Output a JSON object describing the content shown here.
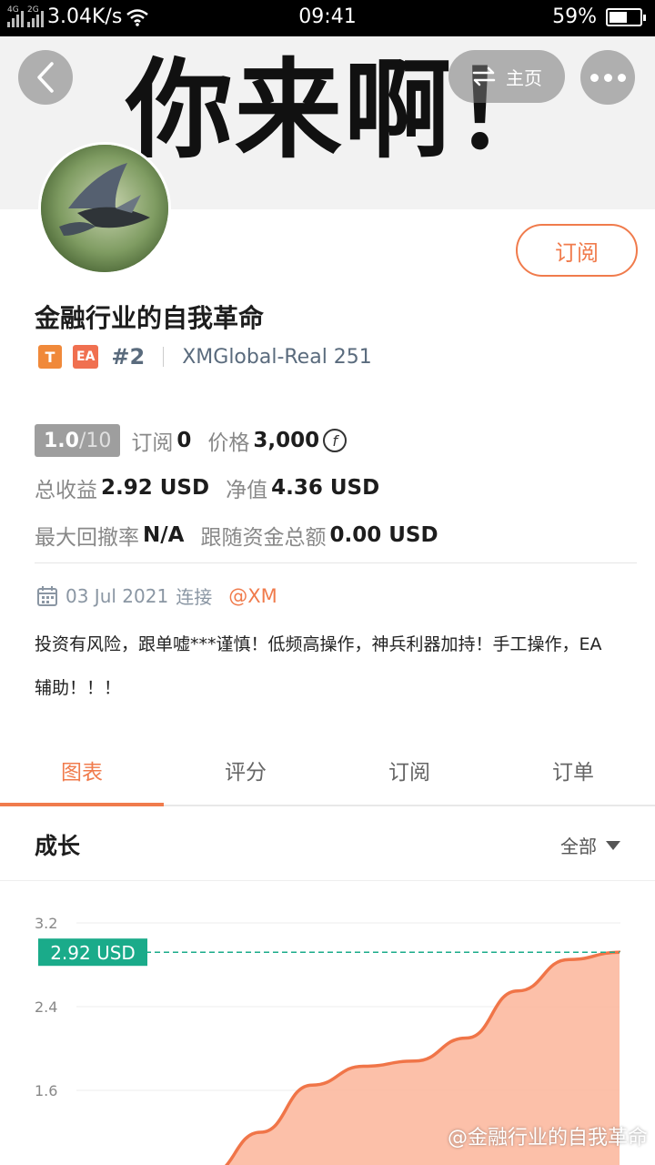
{
  "status_bar": {
    "network_1": "4G",
    "network_2": "2G",
    "speed": "3.04K/s",
    "time": "09:41",
    "battery_percent": "59%",
    "battery_level": 0.59
  },
  "banner": {
    "text": "你来啊！",
    "home_label": "主页"
  },
  "profile": {
    "subscribe_label": "订阅",
    "title": "金融行业的自我革命",
    "badge_t": "T",
    "badge_ea": "EA",
    "rank": "#2",
    "account": "XMGlobal-Real 251"
  },
  "stats": {
    "score": "1.0",
    "score_total": "/10",
    "subscribers_label": "订阅",
    "subscribers_value": "0",
    "price_label": "价格",
    "price_value": "3,000",
    "total_profit_label": "总收益",
    "total_profit_value": "2.92 USD",
    "net_value_label": "净值",
    "net_value_value": "4.36 USD",
    "max_drawdown_label": "最大回撤率",
    "max_drawdown_value": "N/A",
    "follow_total_label": "跟随资金总额",
    "follow_total_value": "0.00 USD"
  },
  "info": {
    "date": "03 Jul 2021",
    "connect_label": "连接",
    "broker": "@XM",
    "description": "投资有风险，跟单嘘***谨慎！低频高操作，神兵利器加持！手工操作，EA辅助！！！"
  },
  "tabs": [
    {
      "label": "图表",
      "active": true
    },
    {
      "label": "评分",
      "active": false
    },
    {
      "label": "订阅",
      "active": false
    },
    {
      "label": "订单",
      "active": false
    }
  ],
  "section": {
    "title": "成长",
    "filter_label": "全部"
  },
  "watermark": "@金融行业的自我革命",
  "colors": {
    "accent": "#f07b4c",
    "teal": "#1aab8a",
    "area_fill": "#fbb59a"
  },
  "chart_data": {
    "type": "area",
    "y_ticks": [
      "3.2",
      "2.4",
      "1.6"
    ],
    "ylim": [
      0.8,
      3.2
    ],
    "current_label": "2.92 USD",
    "current_value": 2.92,
    "x": [
      0,
      1,
      2,
      3,
      4,
      5,
      6,
      7,
      8
    ],
    "values": [
      0.8,
      1.2,
      1.65,
      1.83,
      1.88,
      2.1,
      2.55,
      2.85,
      2.92
    ]
  }
}
